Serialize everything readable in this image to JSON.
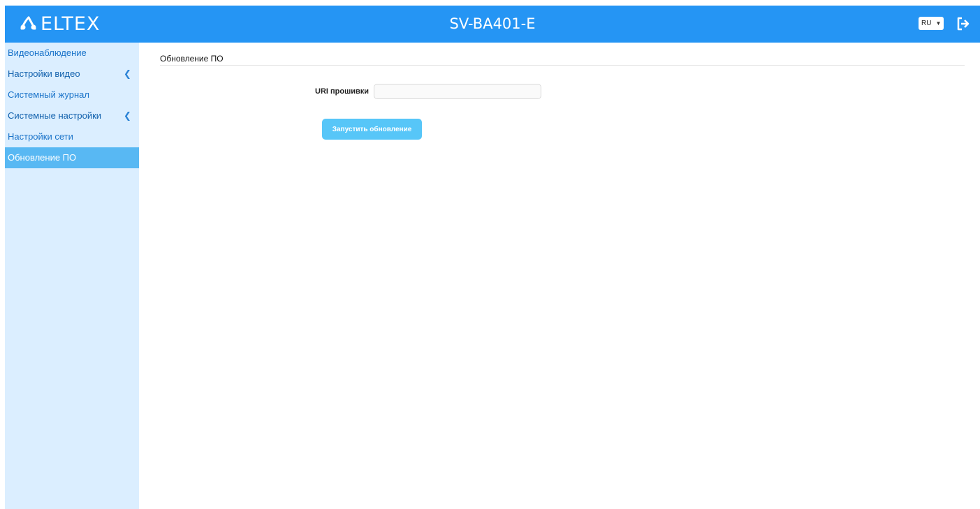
{
  "header": {
    "logo_text": "ELTEX",
    "device_title": "SV-BA401-E",
    "language": "RU"
  },
  "sidebar": {
    "items": [
      {
        "label": "Видеонаблюдение"
      },
      {
        "label": "Настройки видео"
      },
      {
        "label": "Системный журнал"
      },
      {
        "label": "Системные настройки"
      },
      {
        "label": "Настройки сети"
      },
      {
        "label": "Обновление ПО"
      }
    ]
  },
  "main": {
    "page_title": "Обновление ПО",
    "uri_label": "URI прошивки",
    "uri_value": "",
    "start_button": "Запустить обновление"
  },
  "colors": {
    "header_bg": "#2595f4",
    "sidebar_bg": "#dbeeff",
    "active_item_bg": "#58b8f3",
    "button_bg": "#57c6f8"
  },
  "icons": [
    "eltex-logo-icon",
    "chevron-left-icon",
    "caret-down-icon",
    "logout-icon"
  ]
}
